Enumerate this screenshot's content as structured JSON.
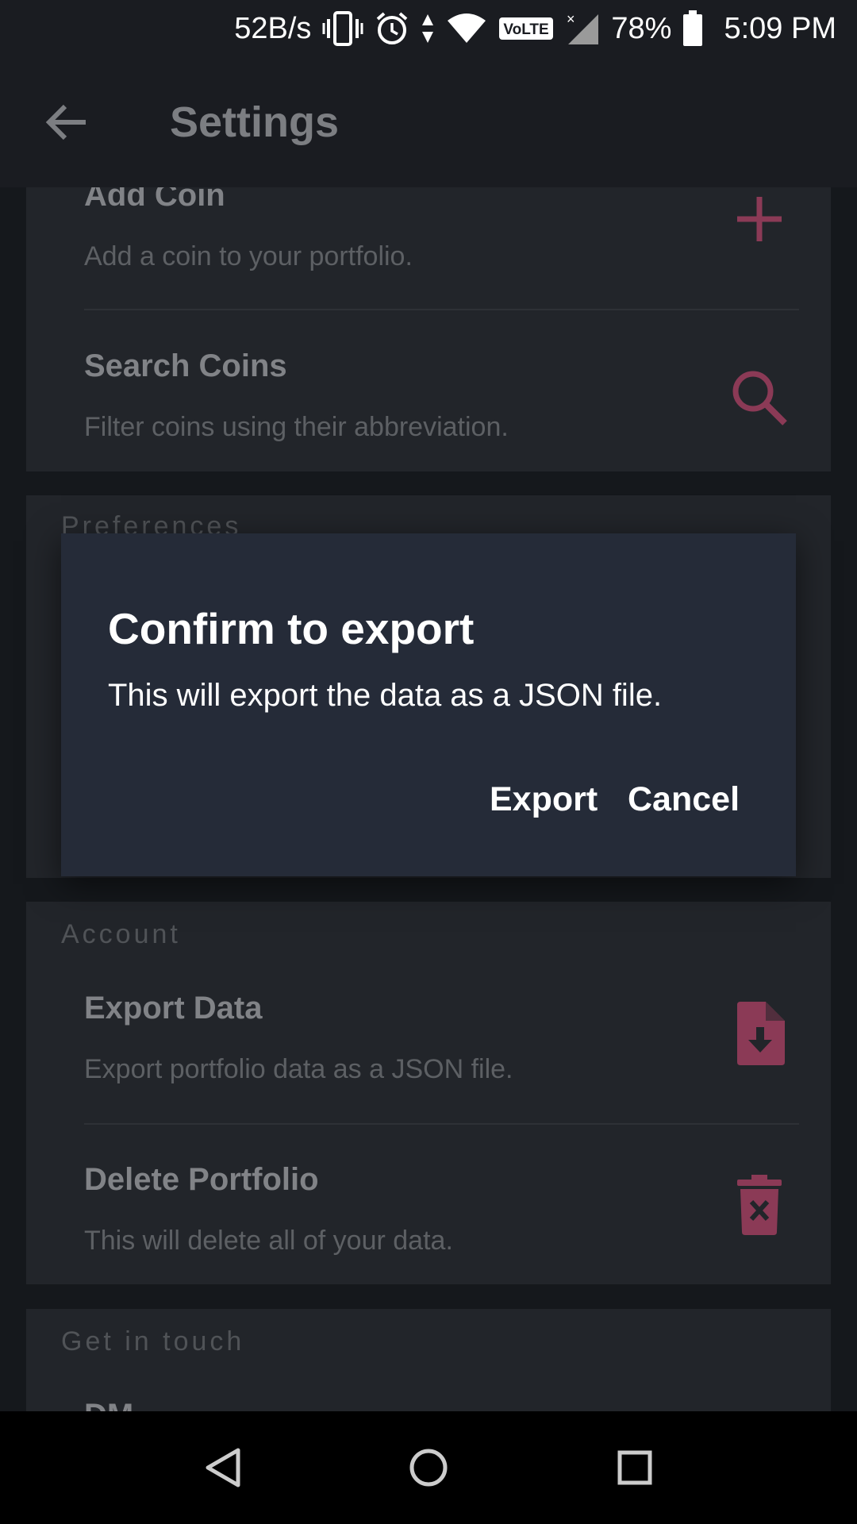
{
  "status_bar": {
    "net_speed": "52B/s",
    "battery": "78%",
    "time": "5:09 PM",
    "volte": "VoLTE"
  },
  "app_bar": {
    "title": "Settings"
  },
  "coins_card": {
    "add_coin": {
      "title": "Add Coin",
      "subtitle": "Add a coin to your portfolio.",
      "icon": "plus-icon"
    },
    "search_coins": {
      "title": "Search Coins",
      "subtitle": "Filter coins using their abbreviation.",
      "icon": "search-icon"
    }
  },
  "preferences_card": {
    "header": "Preferences"
  },
  "account_card": {
    "header": "Account",
    "export_data": {
      "title": "Export Data",
      "subtitle": "Export portfolio data as a JSON file.",
      "icon": "file-download-icon"
    },
    "delete_portfolio": {
      "title": "Delete Portfolio",
      "subtitle": "This will delete all of your data.",
      "icon": "trash-icon"
    }
  },
  "contact_card": {
    "header": "Get in touch",
    "first_item_partial": "DM"
  },
  "dialog": {
    "title": "Confirm to export",
    "message": "This will export the data as a JSON file.",
    "confirm_label": "Export",
    "cancel_label": "Cancel"
  },
  "colors": {
    "accent": "#8b3a56",
    "background": "#15181c",
    "card": "#22252a",
    "dialog": "#252b38"
  }
}
